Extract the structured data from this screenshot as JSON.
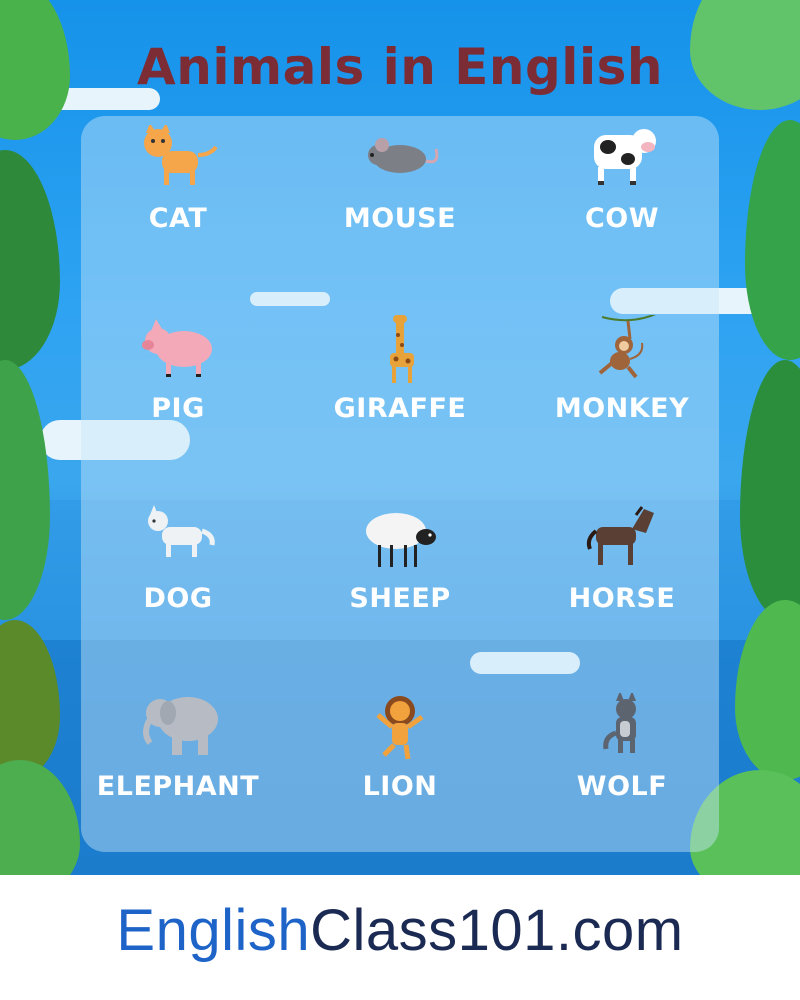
{
  "title": "Animals in English",
  "animals": [
    {
      "label": "CAT",
      "icon": "cat-icon"
    },
    {
      "label": "MOUSE",
      "icon": "mouse-icon"
    },
    {
      "label": "COW",
      "icon": "cow-icon"
    },
    {
      "label": "PIG",
      "icon": "pig-icon"
    },
    {
      "label": "GIRAFFE",
      "icon": "giraffe-icon"
    },
    {
      "label": "MONKEY",
      "icon": "monkey-icon"
    },
    {
      "label": "DOG",
      "icon": "dog-icon"
    },
    {
      "label": "SHEEP",
      "icon": "sheep-icon"
    },
    {
      "label": "HORSE",
      "icon": "horse-icon"
    },
    {
      "label": "ELEPHANT",
      "icon": "elephant-icon"
    },
    {
      "label": "LION",
      "icon": "lion-icon"
    },
    {
      "label": "WOLF",
      "icon": "wolf-icon"
    }
  ],
  "footer": {
    "brand_part1": "English",
    "brand_part2": "Class101.com"
  },
  "colors": {
    "title": "#7b2c34",
    "brand_english": "#1e64c8",
    "brand_class": "#1b2a52",
    "sky": "#2ea3f2"
  }
}
